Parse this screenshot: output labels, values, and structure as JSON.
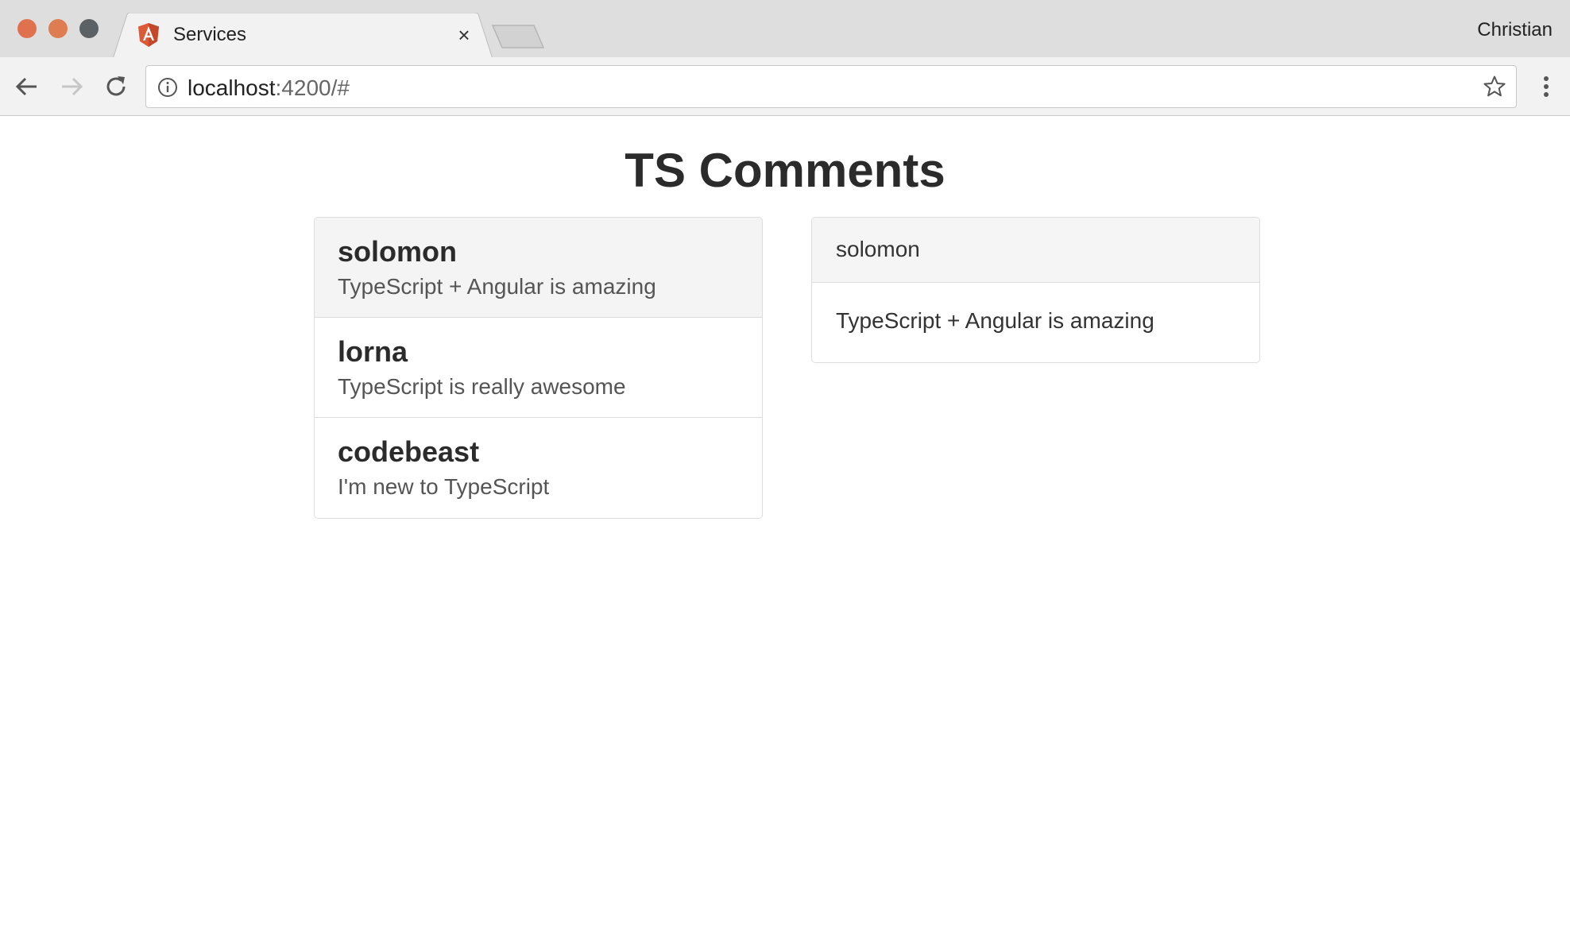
{
  "window": {
    "tab": {
      "title": "Services",
      "favicon": "angular-logo-icon",
      "close_glyph": "×"
    },
    "profile_name": "Christian",
    "colors": {
      "close": "#e0714f",
      "minimize": "#de7c52",
      "maximize": "#5b6165",
      "angular_brand": "#dd5a37"
    }
  },
  "address_bar": {
    "host": "localhost",
    "rest": ":4200/#"
  },
  "page": {
    "title": "TS Comments",
    "comments": [
      {
        "name": "solomon",
        "text": "TypeScript + Angular is amazing",
        "active": true
      },
      {
        "name": "lorna",
        "text": "TypeScript is really awesome",
        "active": false
      },
      {
        "name": "codebeast",
        "text": "I'm new to TypeScript",
        "active": false
      }
    ],
    "detail": {
      "heading": "solomon",
      "body": "TypeScript + Angular is amazing"
    }
  }
}
